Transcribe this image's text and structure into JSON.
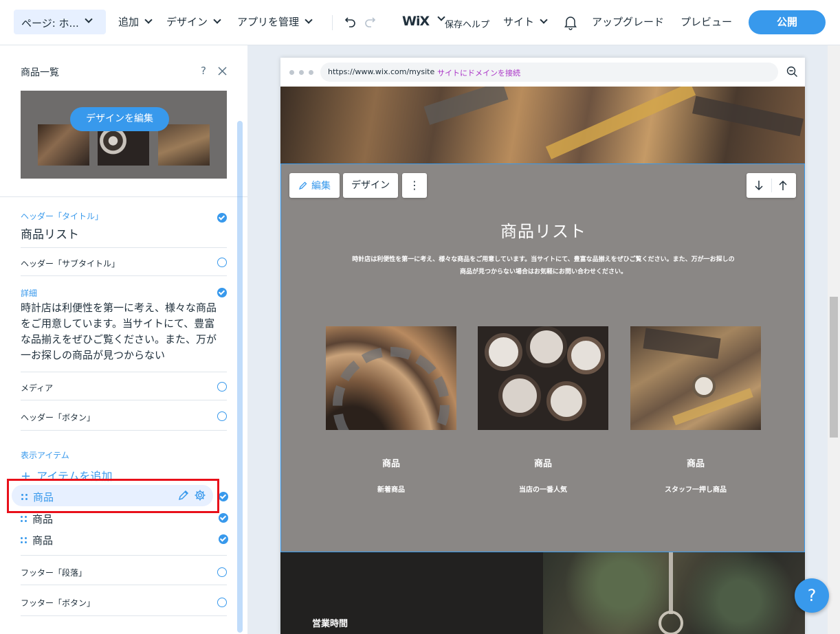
{
  "topbar": {
    "page_select": "ページ: ホ...",
    "menu": [
      {
        "label": "追加"
      },
      {
        "label": "デザイン"
      },
      {
        "label": "アプリを管理"
      }
    ],
    "logo": "WiX",
    "overlap_text": "保存ヘルプ",
    "site": "サイト",
    "upgrade": "アップグレード",
    "preview": "プレビュー",
    "publish": "公開"
  },
  "panel": {
    "title": "商品一覧",
    "help": "?",
    "edit_design": "デザインを編集",
    "header_title_label": "ヘッダー「タイトル」",
    "header_title_value": "商品リスト",
    "header_subtitle_label": "ヘッダー「サブタイトル」",
    "detail_label": "詳細",
    "detail_text": "時計店は利便性を第一に考え、様々な商品をご用意しています。当サイトにて、豊富な品揃えをぜひご覧ください。また、万が一お探しの商品が見つからない",
    "media_label": "メディア",
    "header_button_label": "ヘッダー「ボタン」",
    "display_items_label": "表示アイテム",
    "add_item": "アイテムを追加",
    "items": [
      {
        "label": "商品"
      },
      {
        "label": "商品"
      },
      {
        "label": "商品"
      }
    ],
    "footer_paragraph_label": "フッター「段落」",
    "footer_button_label": "フッター「ボタン」"
  },
  "browser": {
    "url": "https://www.wix.com/mysite",
    "connect_domain": "サイトにドメインを接続"
  },
  "section": {
    "edit_button": "編集",
    "design_button": "デザイン",
    "more": "⋮",
    "title": "商品リスト",
    "subtitle_line1": "時計店は利便性を第一に考え、様々な商品をご用意しています。当サイトにて、豊富な品揃えをぜひご覧ください。また、万が一お探しの",
    "subtitle_line2": "商品が見つからない場合はお気軽にお問い合わせください。",
    "products": [
      {
        "name": "商品",
        "tag": "新着商品"
      },
      {
        "name": "商品",
        "tag": "当店の一番人気"
      },
      {
        "name": "商品",
        "tag": "スタッフ一押し商品"
      }
    ]
  },
  "footer": {
    "hours": "営業時間"
  },
  "help_bubble": "?",
  "colors": {
    "accent": "#3899ec",
    "section_bg": "#8a8785",
    "highlight_red": "#e8101a"
  }
}
